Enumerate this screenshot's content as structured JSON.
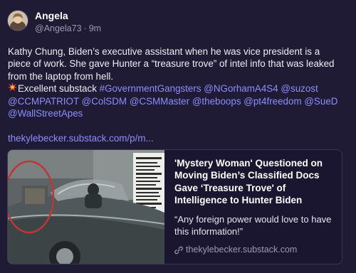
{
  "post": {
    "author": {
      "display_name": "Angela",
      "handle": "@Angela73",
      "time": "9m",
      "separator": "·"
    },
    "text_lines": [
      "Kathy Chung, Biden’s executive assistant when he was vice president is a",
      "piece of work. She gave Hunter a “treasure trove” of intel info that was leaked",
      "from the laptop from hell."
    ],
    "line4_prefix": "Excellent substack ",
    "mentions": {
      "m1": "#GovernmentGangsters",
      "m2": "@NGorhamA4S4",
      "m3": "@suzost",
      "m4": "@CCMPATRIOT",
      "m5": "@ColSDM",
      "m6": "@CSMMaster",
      "m7": "@theboops",
      "m8": "@pt4freedom",
      "m9": "@SueD",
      "m10": "@WallStreetApes"
    },
    "link": "thekylebecker.substack.com/p/m...",
    "card": {
      "title": "'Mystery Woman' Questioned on Moving Biden’s Classified Docs Gave ‘Treasure Trove' of Intelligence to Hunter Biden",
      "description": "“Any foreign power would love to have this information!”",
      "domain": "thekylebecker.substack.com",
      "image_icon": "classic-car-photo",
      "domain_icon": "link-icon"
    }
  },
  "colors": {
    "background": "#1f1b34",
    "link": "#8c8dff",
    "muted": "#9d98b4",
    "text": "#eeecf5",
    "card_border": "#3d3759",
    "highlight_circle": "#c03535"
  }
}
